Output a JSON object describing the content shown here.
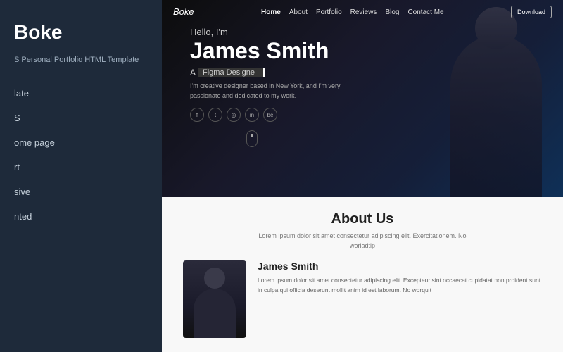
{
  "left_panel": {
    "brand": "Boke",
    "subtitle": "S Personal Portfolio HTML Template",
    "nav_items": [
      {
        "label": "late"
      },
      {
        "label": "S"
      },
      {
        "label": "ome page"
      },
      {
        "label": "rt"
      },
      {
        "label": "sive"
      },
      {
        "label": "nted"
      }
    ]
  },
  "top_nav": {
    "logo": "Boke",
    "links": [
      {
        "label": "Home",
        "active": true
      },
      {
        "label": "About"
      },
      {
        "label": "Portfolio"
      },
      {
        "label": "Reviews"
      },
      {
        "label": "Blog"
      },
      {
        "label": "Contact Me"
      }
    ],
    "download_button": "Download"
  },
  "hero": {
    "greeting": "Hello, I'm",
    "name": "James Smith",
    "role_prefix": "A",
    "role_typed": "Figma Designe |",
    "description": "I'm creative designer based in New York, and I'm very passionate and dedicated to my work.",
    "social_icons": [
      "f",
      "t",
      "in",
      "in",
      "be"
    ],
    "scroll_hint": "scroll"
  },
  "about": {
    "title": "About Us",
    "subtitle": "Lorem ipsum dolor sit amet consectetur adipiscing elit. Exercitationem. No worladtip",
    "person_name": "James Smith",
    "person_description": "Lorem ipsum dolor sit amet consectetur adipiscing elit. Excepteur sint occaecat cupidatat non proident sunt in culpa qui officia deserunt mollit anim id est laborum. No worquit"
  }
}
